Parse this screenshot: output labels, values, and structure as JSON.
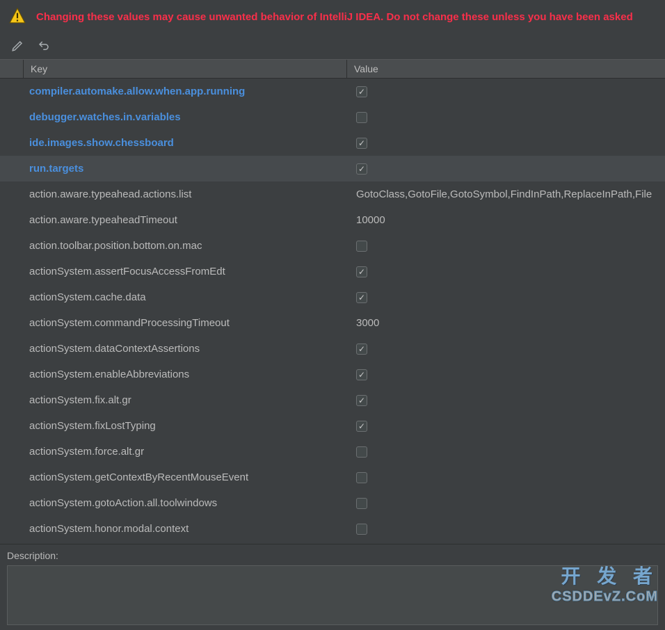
{
  "warning": "Changing these values may cause unwanted behavior of IntelliJ IDEA. Do not change these unless you have been asked",
  "columns": {
    "key": "Key",
    "value": "Value"
  },
  "description_label": "Description:",
  "watermark": {
    "line1": "开 发 者",
    "line2": "CSDDEvZ.CoM"
  },
  "rows": [
    {
      "key": "compiler.automake.allow.when.app.running",
      "type": "check",
      "checked": true,
      "modified": true,
      "selected": false
    },
    {
      "key": "debugger.watches.in.variables",
      "type": "check",
      "checked": false,
      "modified": true,
      "selected": false
    },
    {
      "key": "ide.images.show.chessboard",
      "type": "check",
      "checked": true,
      "modified": true,
      "selected": false
    },
    {
      "key": "run.targets",
      "type": "check",
      "checked": true,
      "modified": true,
      "selected": true
    },
    {
      "key": "action.aware.typeahead.actions.list",
      "type": "text",
      "value": "GotoClass,GotoFile,GotoSymbol,FindInPath,ReplaceInPath,File",
      "modified": false,
      "selected": false
    },
    {
      "key": "action.aware.typeaheadTimeout",
      "type": "text",
      "value": "10000",
      "modified": false,
      "selected": false
    },
    {
      "key": "action.toolbar.position.bottom.on.mac",
      "type": "check",
      "checked": false,
      "modified": false,
      "selected": false
    },
    {
      "key": "actionSystem.assertFocusAccessFromEdt",
      "type": "check",
      "checked": true,
      "modified": false,
      "selected": false
    },
    {
      "key": "actionSystem.cache.data",
      "type": "check",
      "checked": true,
      "modified": false,
      "selected": false
    },
    {
      "key": "actionSystem.commandProcessingTimeout",
      "type": "text",
      "value": "3000",
      "modified": false,
      "selected": false
    },
    {
      "key": "actionSystem.dataContextAssertions",
      "type": "check",
      "checked": true,
      "modified": false,
      "selected": false
    },
    {
      "key": "actionSystem.enableAbbreviations",
      "type": "check",
      "checked": true,
      "modified": false,
      "selected": false
    },
    {
      "key": "actionSystem.fix.alt.gr",
      "type": "check",
      "checked": true,
      "modified": false,
      "selected": false
    },
    {
      "key": "actionSystem.fixLostTyping",
      "type": "check",
      "checked": true,
      "modified": false,
      "selected": false
    },
    {
      "key": "actionSystem.force.alt.gr",
      "type": "check",
      "checked": false,
      "modified": false,
      "selected": false
    },
    {
      "key": "actionSystem.getContextByRecentMouseEvent",
      "type": "check",
      "checked": false,
      "modified": false,
      "selected": false
    },
    {
      "key": "actionSystem.gotoAction.all.toolwindows",
      "type": "check",
      "checked": false,
      "modified": false,
      "selected": false
    },
    {
      "key": "actionSystem.honor.modal.context",
      "type": "check",
      "checked": false,
      "modified": false,
      "selected": false
    }
  ]
}
